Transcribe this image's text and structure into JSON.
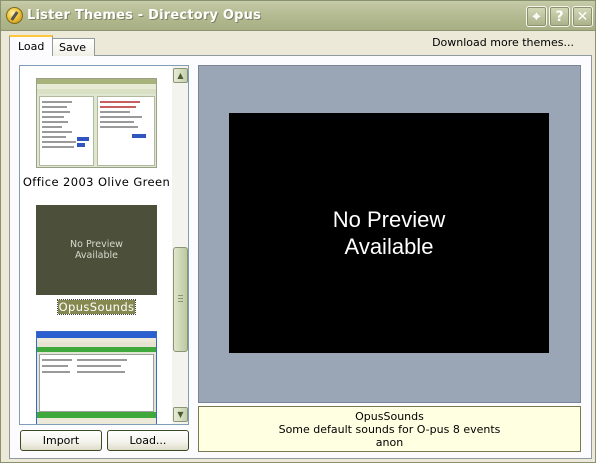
{
  "window": {
    "title": "Lister Themes - Directory Opus",
    "buttons": {
      "pin": "⌖",
      "help": "?",
      "close": "✕"
    }
  },
  "tabs": [
    {
      "label": "Load",
      "active": true
    },
    {
      "label": "Save",
      "active": false
    }
  ],
  "download_link": "Download more themes...",
  "themes": [
    {
      "name": "Office 2003 Olive Green",
      "preview": "thumbnail"
    },
    {
      "name": "OpusSounds",
      "preview": "none",
      "selected": true,
      "placeholder": "No Preview Available"
    },
    {
      "name": "",
      "preview": "thumbnail"
    }
  ],
  "buttons": {
    "import": "Import",
    "load": "Load..."
  },
  "preview": {
    "text": "No Preview Available"
  },
  "info": {
    "name": "OpusSounds",
    "description": "Some default sounds for O-pus 8 events",
    "author": "anon"
  },
  "colors": {
    "titlebar": "#b5bb92",
    "selection": "#85894f",
    "preview_bg": "#9aa6b6",
    "info_bg": "#ffffe1"
  }
}
